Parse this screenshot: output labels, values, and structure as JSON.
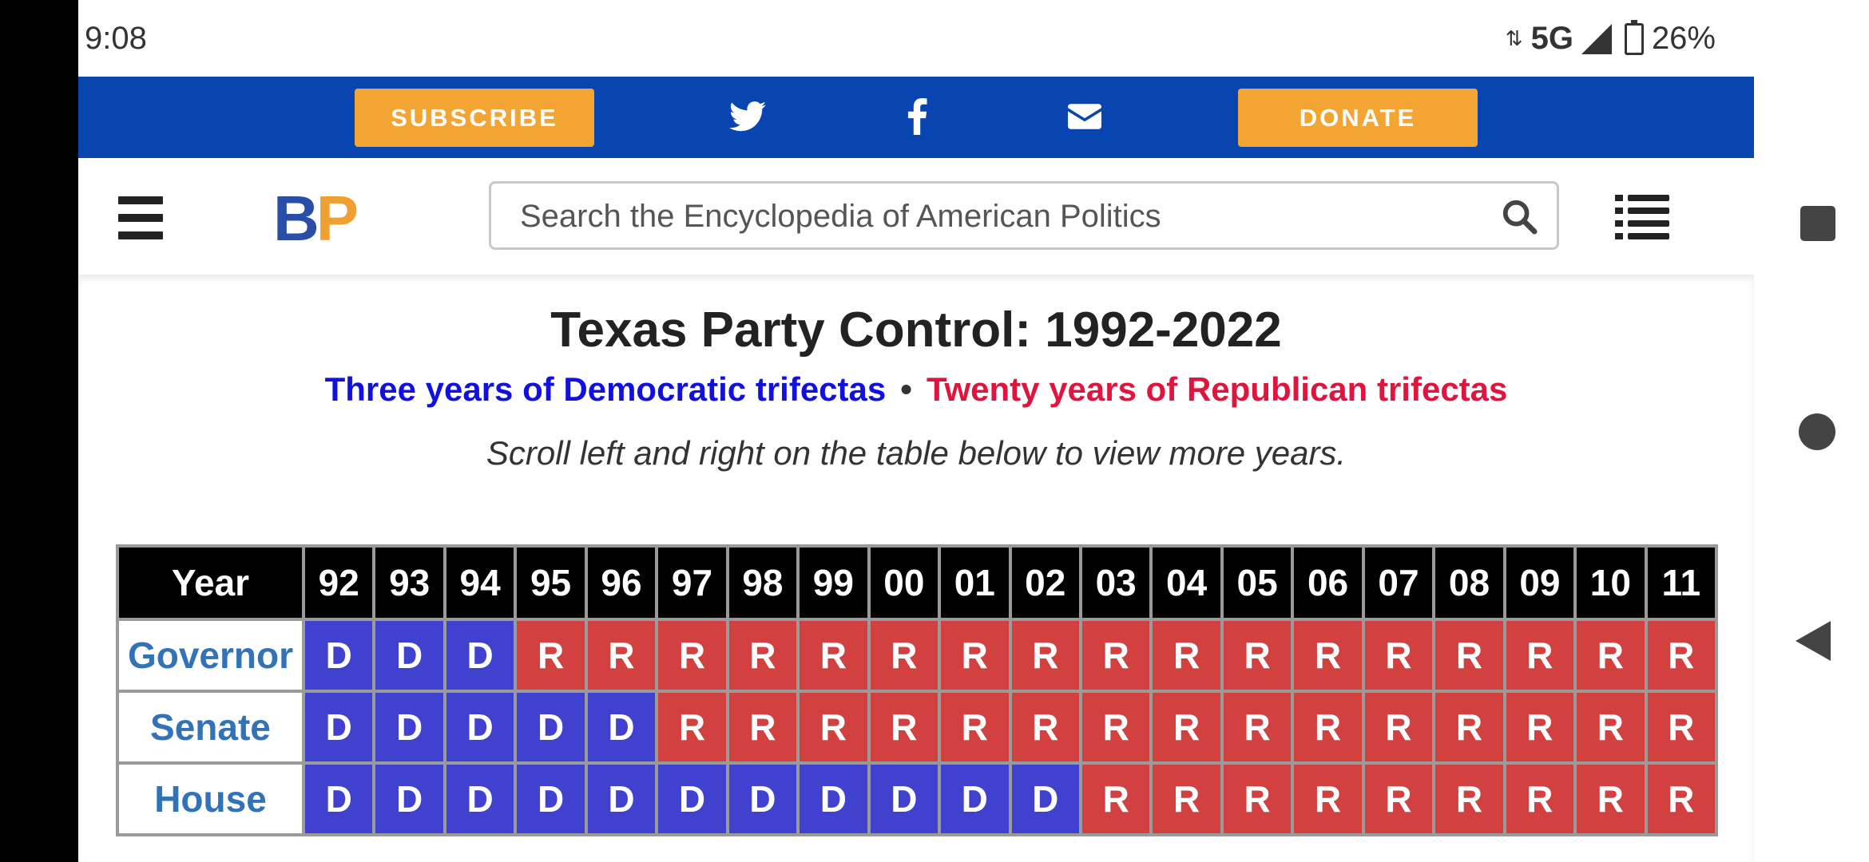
{
  "status_bar": {
    "time": "9:08",
    "network": "5G",
    "battery": "26%"
  },
  "top_bar": {
    "subscribe_label": "SUBSCRIBE",
    "donate_label": "DONATE"
  },
  "header": {
    "logo_b": "B",
    "logo_p": "P",
    "search_placeholder": "Search the Encyclopedia of American Politics"
  },
  "content": {
    "title": "Texas Party Control: 1992-2022",
    "dem_text": "Three years of Democratic trifectas",
    "separator": "•",
    "rep_text": "Twenty years of Republican trifectas",
    "note": "Scroll left and right on the table below to view more years."
  },
  "colors": {
    "democrat": "#4141cf",
    "republican": "#d24040",
    "accent_blue": "#0845b0",
    "accent_orange": "#f3a534"
  },
  "table": {
    "header_label": "Year",
    "years": [
      "92",
      "93",
      "94",
      "95",
      "96",
      "97",
      "98",
      "99",
      "00",
      "01",
      "02",
      "03",
      "04",
      "05",
      "06",
      "07",
      "08",
      "09",
      "10",
      "11"
    ],
    "rows": [
      {
        "label": "Governor",
        "values": [
          "D",
          "D",
          "D",
          "R",
          "R",
          "R",
          "R",
          "R",
          "R",
          "R",
          "R",
          "R",
          "R",
          "R",
          "R",
          "R",
          "R",
          "R",
          "R",
          "R"
        ]
      },
      {
        "label": "Senate",
        "values": [
          "D",
          "D",
          "D",
          "D",
          "D",
          "R",
          "R",
          "R",
          "R",
          "R",
          "R",
          "R",
          "R",
          "R",
          "R",
          "R",
          "R",
          "R",
          "R",
          "R"
        ]
      },
      {
        "label": "House",
        "values": [
          "D",
          "D",
          "D",
          "D",
          "D",
          "D",
          "D",
          "D",
          "D",
          "D",
          "D",
          "R",
          "R",
          "R",
          "R",
          "R",
          "R",
          "R",
          "R",
          "R"
        ]
      }
    ]
  }
}
